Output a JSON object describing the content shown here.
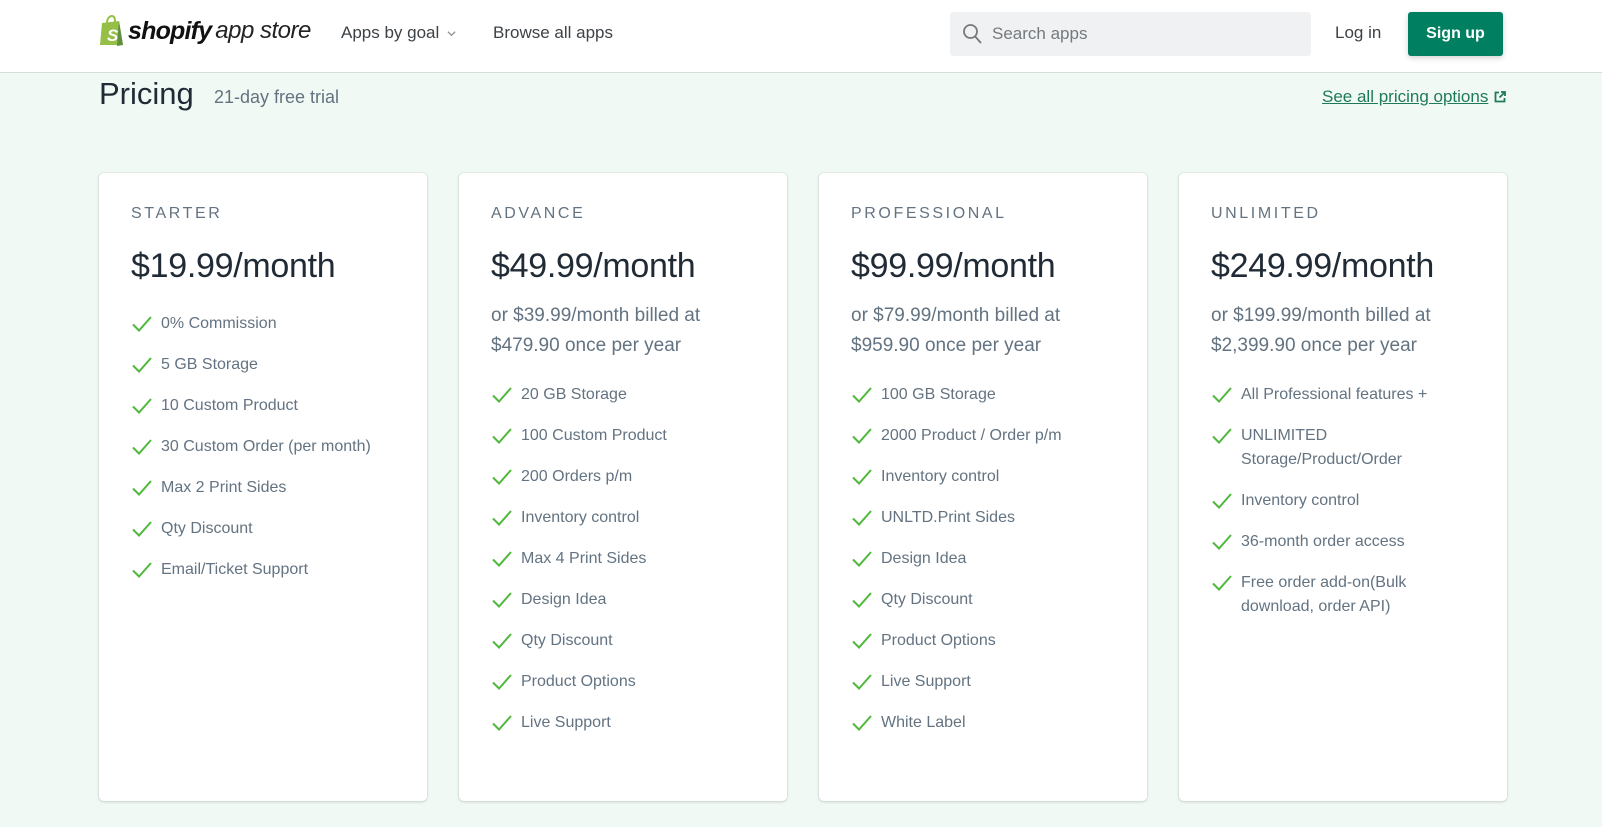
{
  "header": {
    "logo_word": "shopify",
    "logo_sub": "app store",
    "nav": {
      "apps_by_goal": "Apps by goal",
      "browse_all": "Browse all apps"
    },
    "search": {
      "placeholder": "Search apps",
      "value": ""
    },
    "login_label": "Log in",
    "signup_label": "Sign up"
  },
  "pricing": {
    "title": "Pricing",
    "trial": "21-day free trial",
    "see_all_label": "See all pricing options",
    "plans": [
      {
        "name": "STARTER",
        "price": "$19.99/month",
        "features": [
          "0% Commission",
          "5 GB Storage",
          "10 Custom Product",
          "30 Custom Order (per month)",
          "Max 2 Print Sides",
          "Qty Discount",
          "Email/Ticket Support"
        ]
      },
      {
        "name": "ADVANCE",
        "price": "$49.99/month",
        "annual": "or $39.99/month billed at $479.90 once per year",
        "features": [
          "20 GB Storage",
          "100 Custom Product",
          "200 Orders p/m",
          "Inventory control",
          "Max 4 Print Sides",
          "Design Idea",
          "Qty Discount",
          "Product Options",
          "Live Support"
        ]
      },
      {
        "name": "PROFESSIONAL",
        "price": "$99.99/month",
        "annual": "or $79.99/month billed at $959.90 once per year",
        "features": [
          "100 GB Storage",
          "2000 Product / Order p/m",
          "Inventory control",
          "UNLTD.Print Sides",
          "Design Idea",
          "Qty Discount",
          "Product Options",
          "Live Support",
          "White Label"
        ]
      },
      {
        "name": "UNLIMITED",
        "price": "$249.99/month",
        "annual": "or $199.99/month billed at $2,399.90 once per year",
        "features": [
          "All Professional features +",
          "UNLIMITED Storage/Product/Order",
          "Inventory control",
          "36-month order access",
          "Free order add-on(Bulk download, order API)"
        ]
      }
    ]
  },
  "colors": {
    "brand_green": "#008060",
    "logo_green": "#95bf47",
    "check_green": "#50b83c",
    "page_bg": "#f1f9f4",
    "link_green": "#1f7a5c"
  }
}
